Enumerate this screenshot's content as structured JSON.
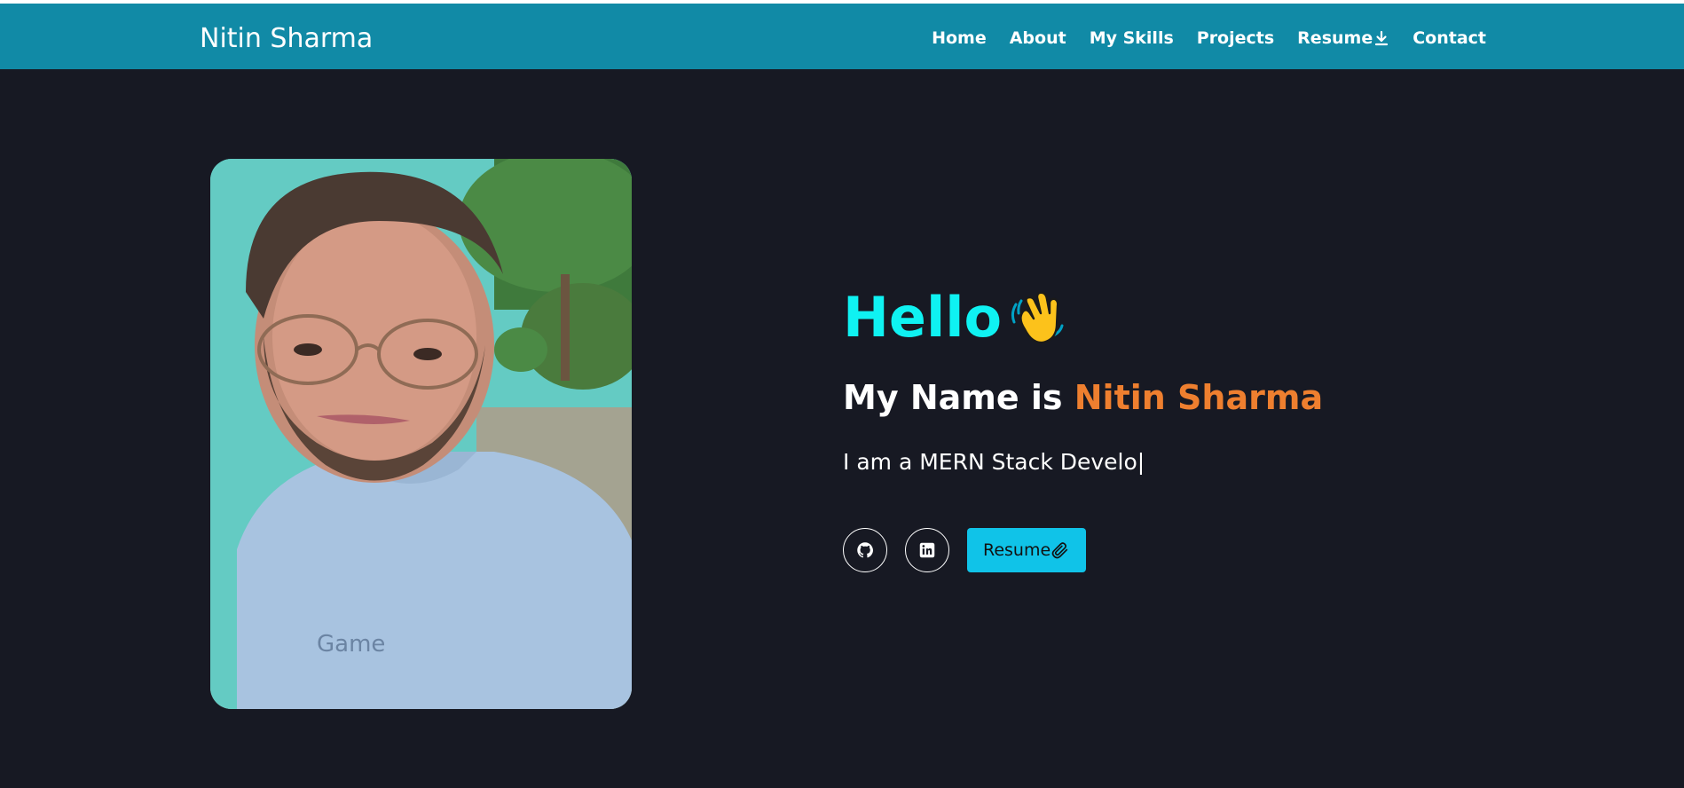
{
  "navbar": {
    "brand": "Nitin Sharma",
    "links": [
      {
        "label": "Home"
      },
      {
        "label": "About"
      },
      {
        "label": "My Skills"
      },
      {
        "label": "Projects"
      },
      {
        "label": "Resume",
        "icon": "download-icon"
      },
      {
        "label": "Contact"
      }
    ]
  },
  "hero": {
    "greeting": "Hello",
    "greeting_emoji": "waving-hand-icon",
    "name_prefix": "My Name is",
    "name": "Nitin Sharma",
    "typing_text": "I am a MERN Stack Develo|",
    "resume_button": "Resume",
    "social": [
      "github-icon",
      "linkedin-icon"
    ]
  },
  "colors": {
    "navbar_bg": "#118aa6",
    "page_bg": "#171923",
    "greeting": "#0ff2f2",
    "name_accent": "#ee7f2f",
    "resume_button_bg": "#10c3e8"
  }
}
